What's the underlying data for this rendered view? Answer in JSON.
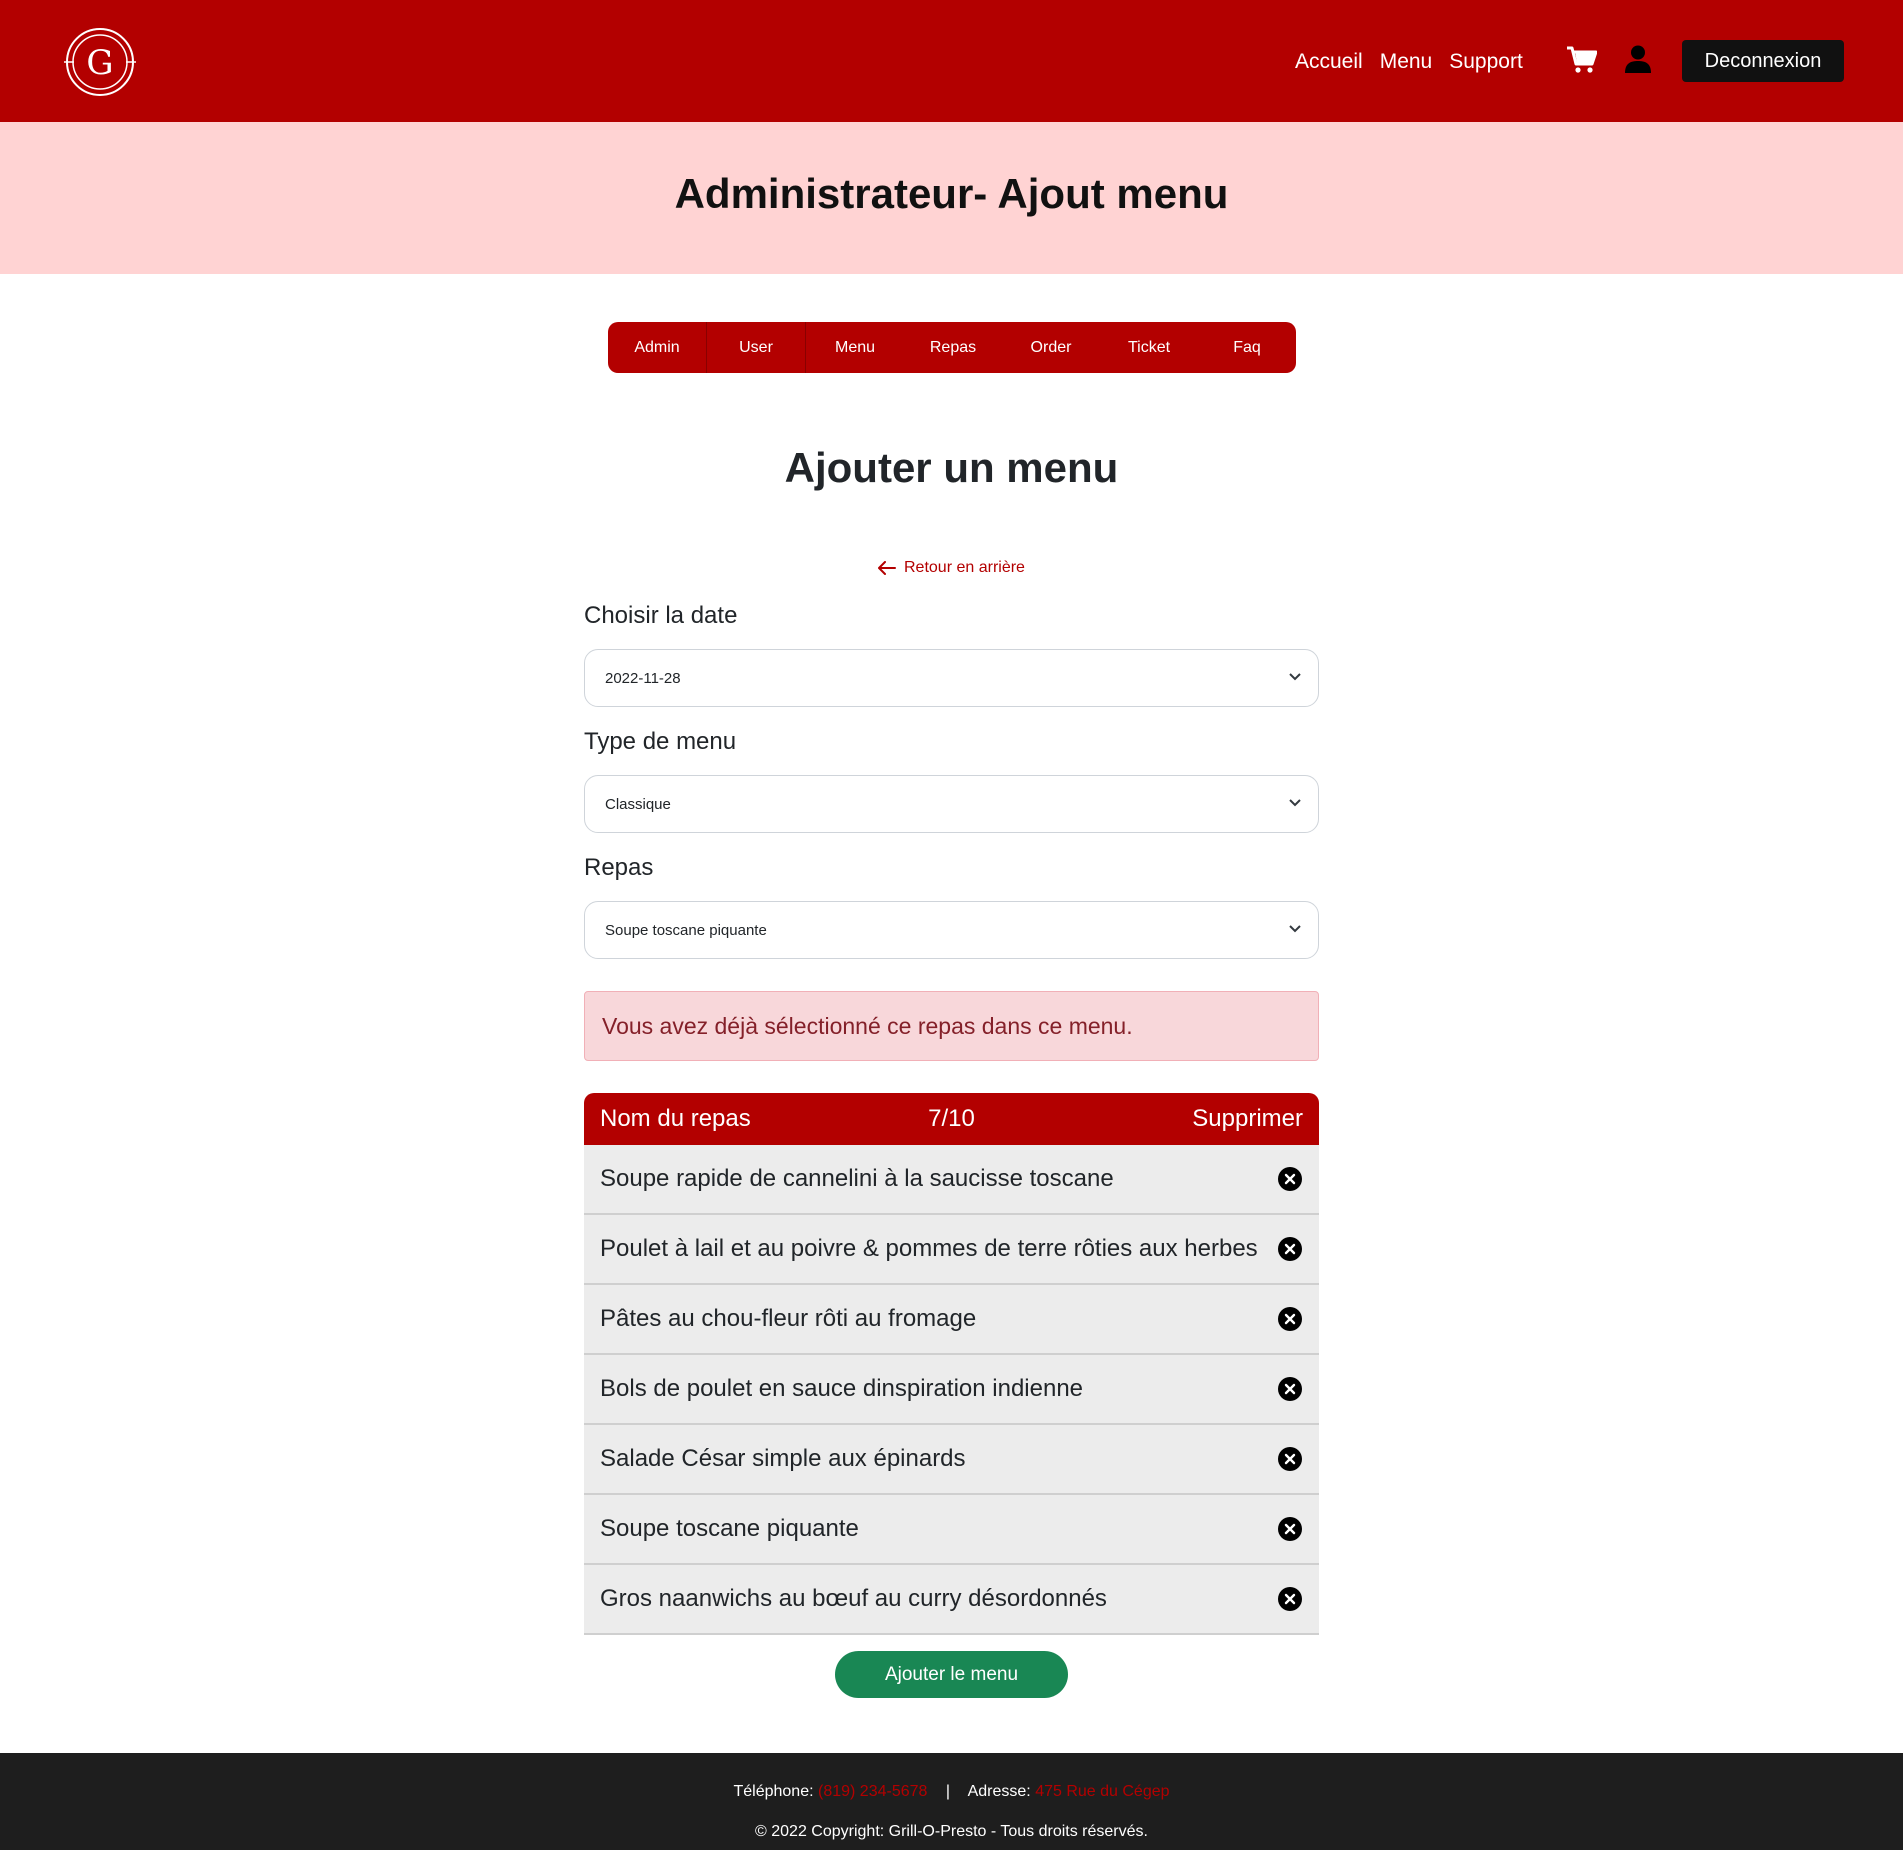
{
  "header": {
    "nav": [
      "Accueil",
      "Menu",
      "Support"
    ],
    "logout_label": "Deconnexion",
    "logo_letter": "G"
  },
  "banner": {
    "title": "Administrateur- Ajout menu"
  },
  "admin_tabs": [
    "Admin",
    "User",
    "Menu",
    "Repas",
    "Order",
    "Ticket",
    "Faq"
  ],
  "form": {
    "title": "Ajouter un menu",
    "back_label": "Retour en arrière",
    "date_label": "Choisir la date",
    "date_value": "2022-11-28",
    "type_label": "Type de menu",
    "type_value": "Classique",
    "meal_label": "Repas",
    "meal_value": "Soupe toscane piquante",
    "alert": "Vous avez déjà sélectionné ce repas dans ce menu.",
    "submit_label": "Ajouter le menu"
  },
  "table": {
    "col_name": "Nom du repas",
    "count": "7/10",
    "col_delete": "Supprimer",
    "rows": [
      "Soupe rapide de cannelini à la saucisse toscane",
      "Poulet à lail et au poivre & pommes de terre rôties aux herbes",
      "Pâtes au chou-fleur rôti au fromage",
      "Bols de poulet en sauce dinspiration indienne",
      "Salade César simple aux épinards",
      "Soupe toscane piquante",
      "Gros naanwichs au bœuf au curry désordonnés"
    ]
  },
  "footer": {
    "phone_label": "Téléphone:",
    "phone_value": "(819) 234-5678",
    "separator": "|",
    "address_label": "Adresse:",
    "address_value": "475 Rue du Cégep",
    "copyright": "© 2022 Copyright: Grill-O-Presto - Tous droits réservés."
  },
  "colors": {
    "brand_red": "#b30000",
    "banner_pink": "#ffd3d3",
    "success_green": "#198754",
    "footer_dark": "#1e1e1e"
  }
}
